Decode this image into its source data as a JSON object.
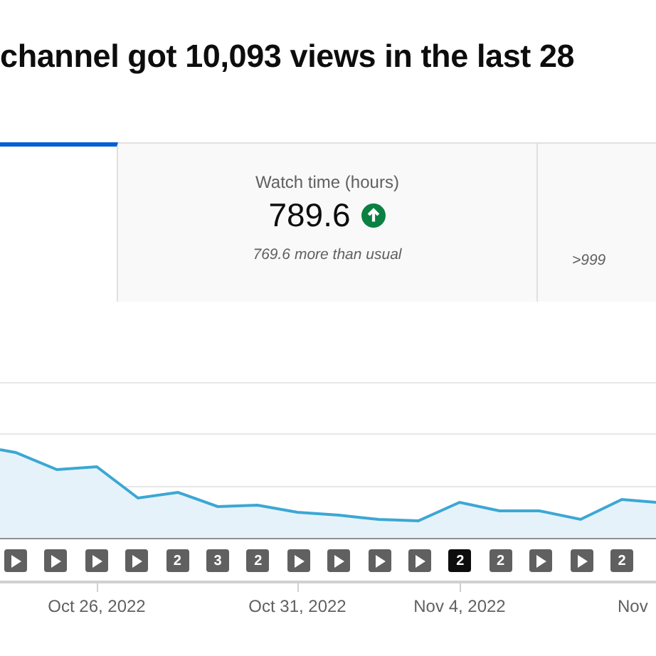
{
  "heading": "channel got 10,093 views in the last 28",
  "tabs": [
    {
      "selected": true
    },
    {
      "selected": false,
      "label": "Watch time (hours)",
      "value": "789.6",
      "increase": true,
      "note": "769.6 more than usual"
    },
    {
      "selected": false,
      "note": ">999"
    }
  ],
  "markers": [
    {
      "kind": "video",
      "selected": false
    },
    {
      "kind": "video",
      "selected": false
    },
    {
      "kind": "video",
      "selected": false
    },
    {
      "kind": "video",
      "selected": false
    },
    {
      "kind": "count",
      "label": "2",
      "selected": false
    },
    {
      "kind": "count",
      "label": "3",
      "selected": false
    },
    {
      "kind": "count",
      "label": "2",
      "selected": false
    },
    {
      "kind": "video",
      "selected": false
    },
    {
      "kind": "video",
      "selected": false
    },
    {
      "kind": "video",
      "selected": false
    },
    {
      "kind": "video",
      "selected": false
    },
    {
      "kind": "count",
      "label": "2",
      "selected": true
    },
    {
      "kind": "count",
      "label": "2",
      "selected": false
    },
    {
      "kind": "video",
      "selected": false
    },
    {
      "kind": "video",
      "selected": false
    },
    {
      "kind": "count",
      "label": "2",
      "selected": false
    }
  ],
  "x_axis_labels": [
    "Oct 26, 2022",
    "Oct 31, 2022",
    "Nov 4, 2022",
    "Nov"
  ]
}
